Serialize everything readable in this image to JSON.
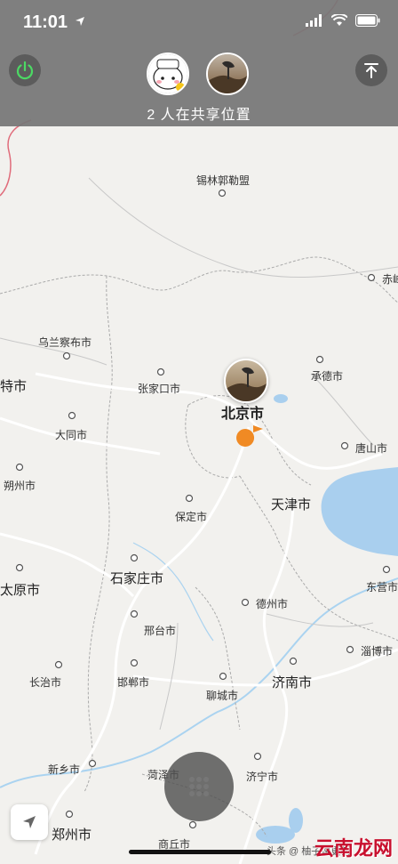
{
  "status_bar": {
    "time": "11:01"
  },
  "header": {
    "share_label": "2 人在共享位置"
  },
  "cities": [
    {
      "name": "锡林郭勒盟"
    },
    {
      "name": "赤峰"
    },
    {
      "name": "乌兰察布市"
    },
    {
      "name": "张家口市"
    },
    {
      "name": "承德市"
    },
    {
      "name": "特市"
    },
    {
      "name": "北京市"
    },
    {
      "name": "大同市"
    },
    {
      "name": "唐山市"
    },
    {
      "name": "朔州市"
    },
    {
      "name": "天津市"
    },
    {
      "name": "保定市"
    },
    {
      "name": "石家庄市"
    },
    {
      "name": "太原市"
    },
    {
      "name": "东营市"
    },
    {
      "name": "德州市"
    },
    {
      "name": "邢台市"
    },
    {
      "name": "淄博市"
    },
    {
      "name": "长治市"
    },
    {
      "name": "邯郸市"
    },
    {
      "name": "济南市"
    },
    {
      "name": "聊城市"
    },
    {
      "name": "新乡市"
    },
    {
      "name": "菏泽市"
    },
    {
      "name": "济宁市"
    },
    {
      "name": "郑州市"
    },
    {
      "name": "商丘市"
    }
  ],
  "watermark": {
    "text": "云南龙网",
    "small": "头条 @ 柚子说更新"
  },
  "colors": {
    "panel": "#777777",
    "power_green": "#4cd964",
    "marker": "#f08a24",
    "water": "#aad3f0"
  }
}
